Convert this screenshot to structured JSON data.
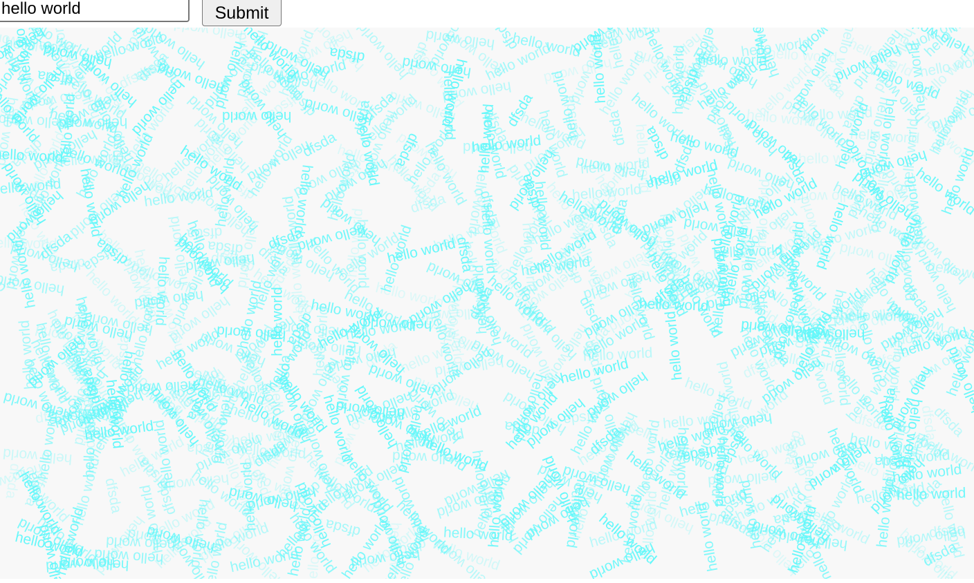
{
  "form": {
    "input_value": "hello world",
    "submit_label": "Submit"
  },
  "canvas": {
    "background_color": "#f8f8f8",
    "word_color": "#63f8fb",
    "word_texts": [
      "hello world",
      "dfsda"
    ]
  }
}
